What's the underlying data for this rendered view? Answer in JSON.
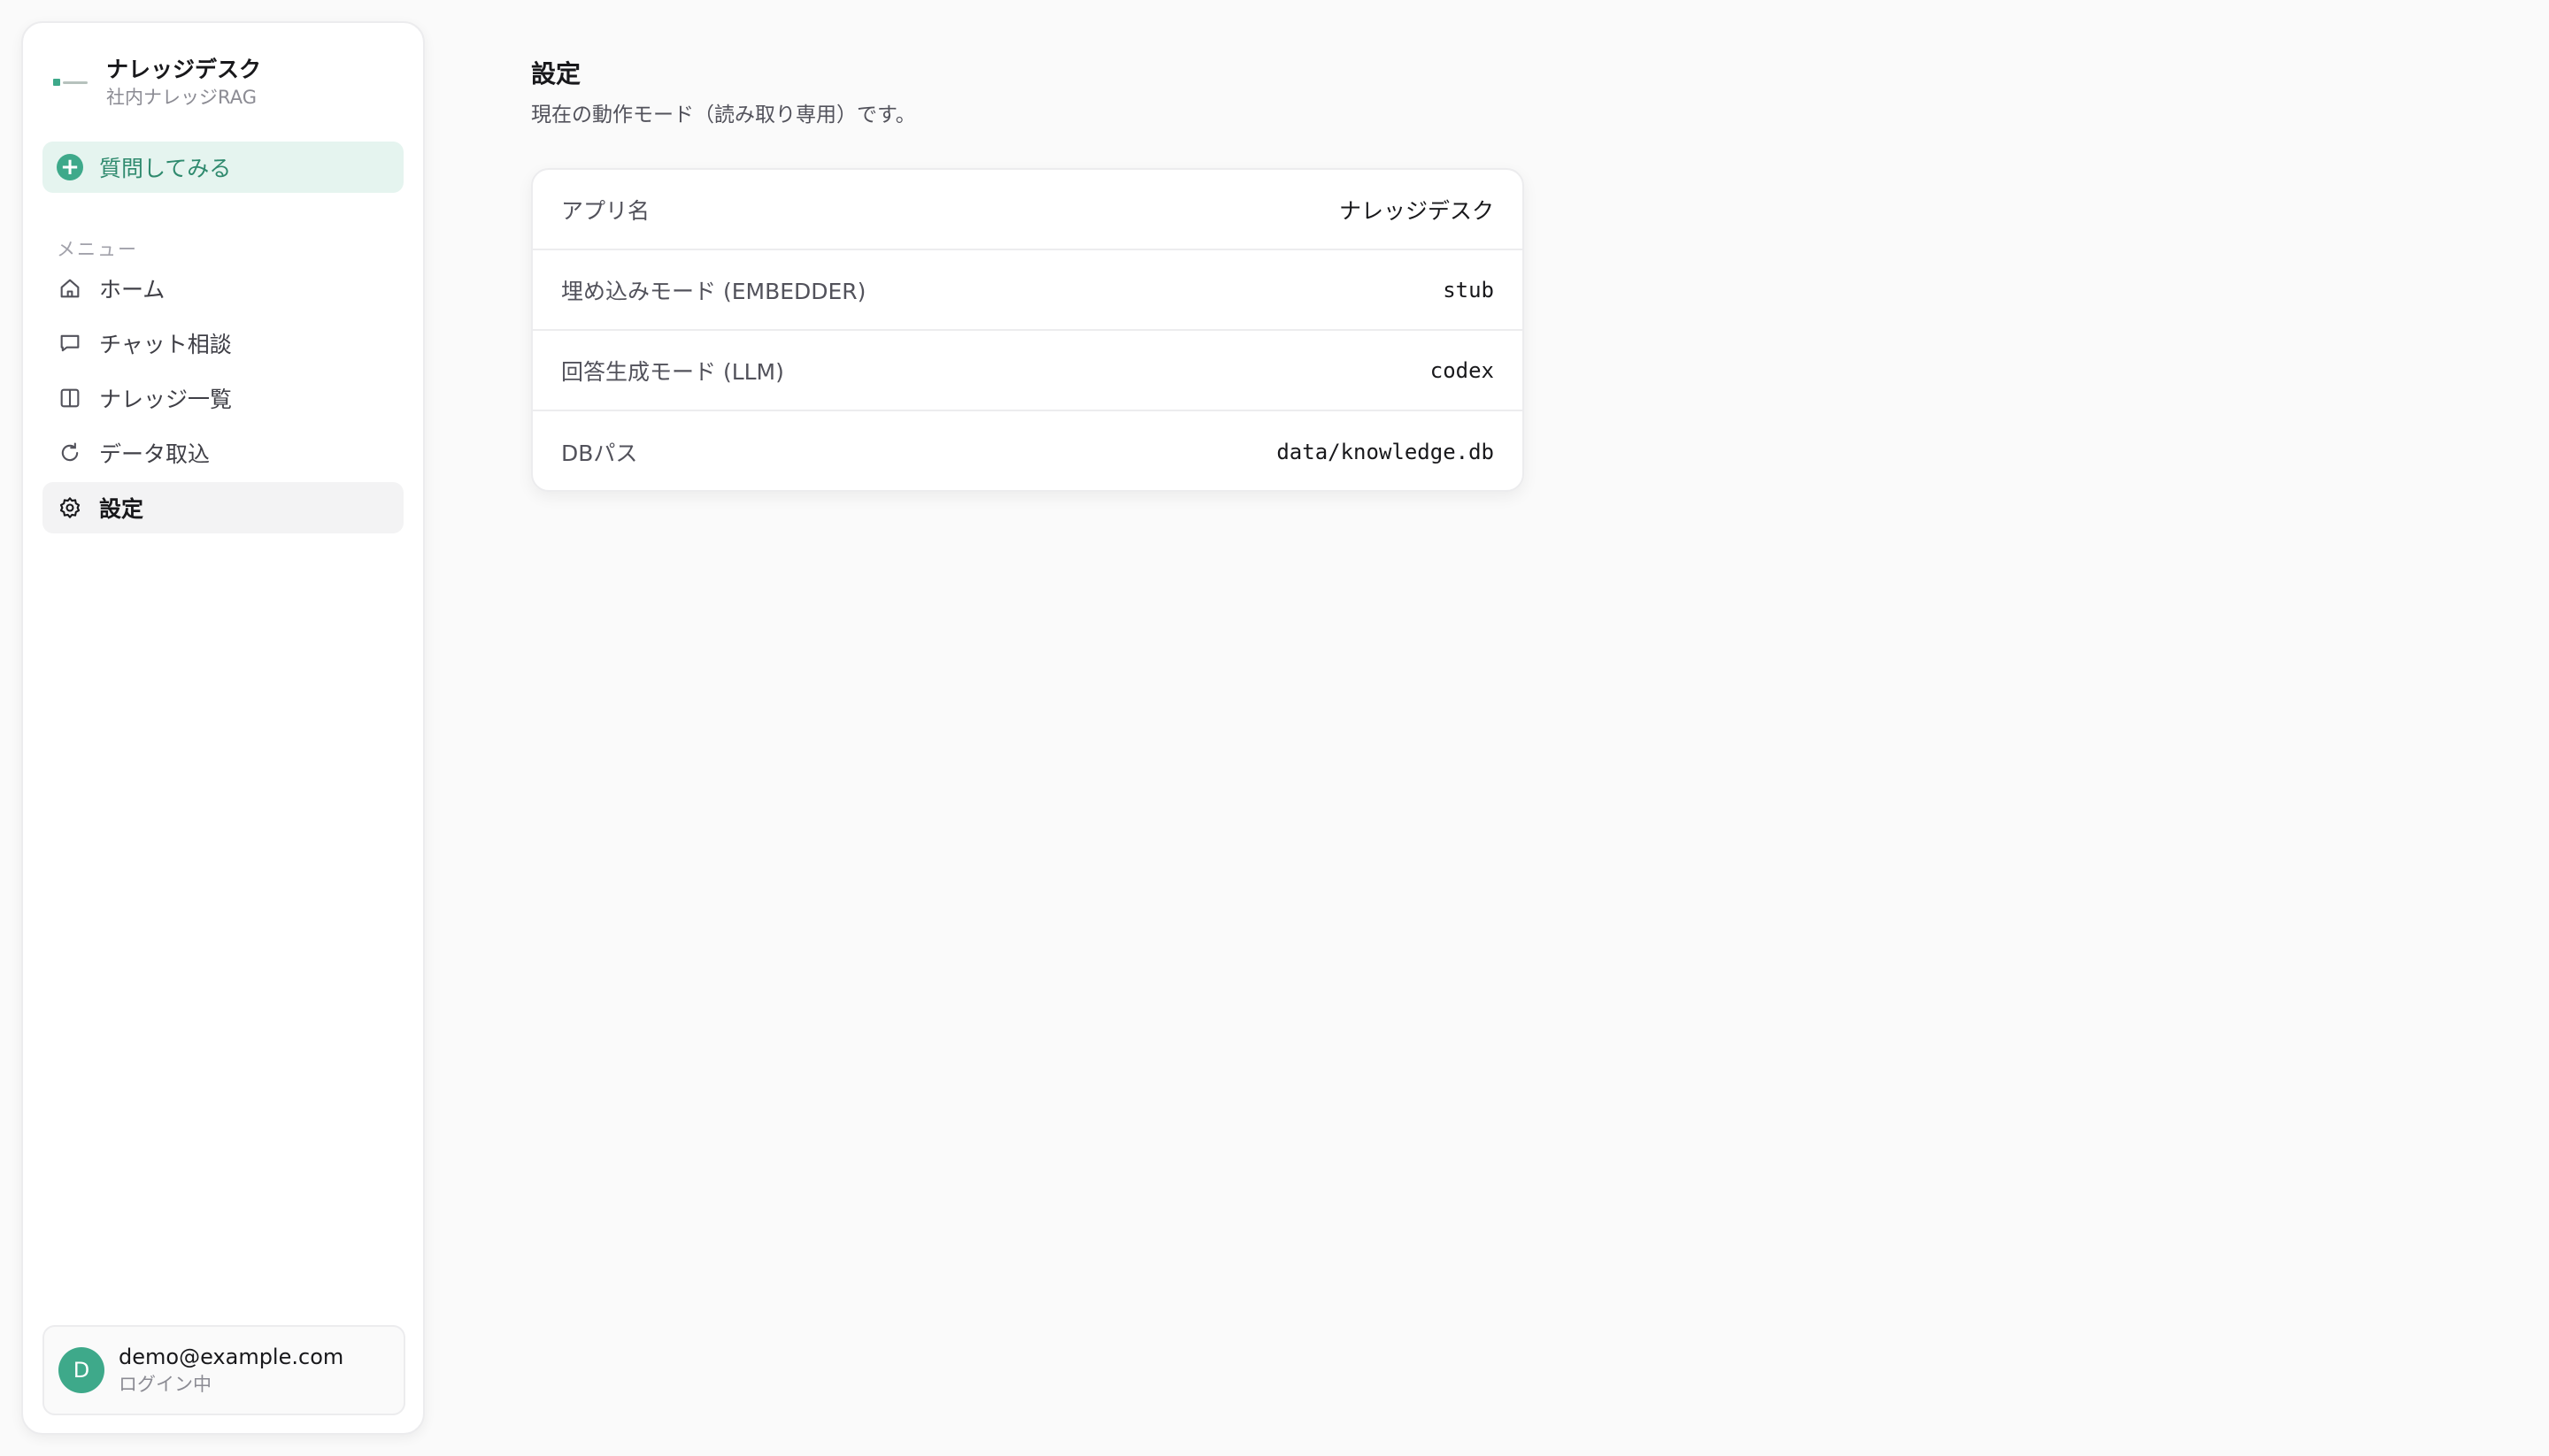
{
  "sidebar": {
    "brand": {
      "title": "ナレッジデスク",
      "subtitle": "社内ナレッジRAG"
    },
    "ask_button": {
      "label": "質問してみる",
      "icon": "plus-circle-icon"
    },
    "menu_heading": "メニュー",
    "items": [
      {
        "label": "ホーム",
        "icon": "home-icon",
        "active": false
      },
      {
        "label": "チャット相談",
        "icon": "chat-icon",
        "active": false
      },
      {
        "label": "ナレッジ一覧",
        "icon": "book-icon",
        "active": false
      },
      {
        "label": "データ取込",
        "icon": "refresh-icon",
        "active": false
      },
      {
        "label": "設定",
        "icon": "gear-icon",
        "active": true
      }
    ],
    "user": {
      "initial": "D",
      "email": "demo@example.com",
      "status": "ログイン中"
    }
  },
  "main": {
    "title": "設定",
    "description": "現在の動作モード（読み取り専用）です。",
    "settings": [
      {
        "label": "アプリ名",
        "value": "ナレッジデスク",
        "mono": false
      },
      {
        "label": "埋め込みモード (EMBEDDER)",
        "value": "stub",
        "mono": true
      },
      {
        "label": "回答生成モード (LLM)",
        "value": "codex",
        "mono": true
      },
      {
        "label": "DBパス",
        "value": "data/knowledge.db",
        "mono": true
      }
    ]
  },
  "colors": {
    "accent": "#3ea98a",
    "accent_bg": "#e5f4ef",
    "accent_text": "#2f8a6e",
    "background": "#fafafa"
  }
}
